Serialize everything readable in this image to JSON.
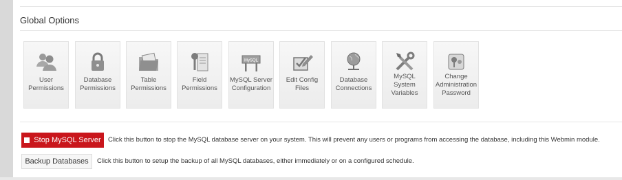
{
  "section": {
    "title": "Global Options"
  },
  "tiles": [
    {
      "label": "User\nPermissions",
      "icon": "users-icon"
    },
    {
      "label": "Database\nPermissions",
      "icon": "lock-icon"
    },
    {
      "label": "Table\nPermissions",
      "icon": "table-folder-icon"
    },
    {
      "label": "Field\nPermissions",
      "icon": "file-key-icon"
    },
    {
      "label": "MySQL Server\nConfiguration",
      "icon": "mysql-sign-icon"
    },
    {
      "label": "Edit Config\nFiles",
      "icon": "edit-checkbox-icon"
    },
    {
      "label": "Database\nConnections",
      "icon": "globe-network-icon"
    },
    {
      "label": "MySQL\nSystem\nVariables",
      "icon": "tools-icon"
    },
    {
      "label": "Change\nAdministration\nPassword",
      "icon": "key-icon"
    }
  ],
  "actions": {
    "stop": {
      "label": "Stop MySQL Server",
      "description": "Click this button to stop the MySQL database server on your system. This will prevent any users or programs from accessing the database, including this Webmin module."
    },
    "backup": {
      "label": "Backup Databases",
      "description": "Click this button to setup the backup of all MySQL databases, either immediately or on a configured schedule."
    }
  },
  "colors": {
    "stop_button": "#c9161c",
    "panel": "#ffffff",
    "background": "#d9d9d9"
  }
}
